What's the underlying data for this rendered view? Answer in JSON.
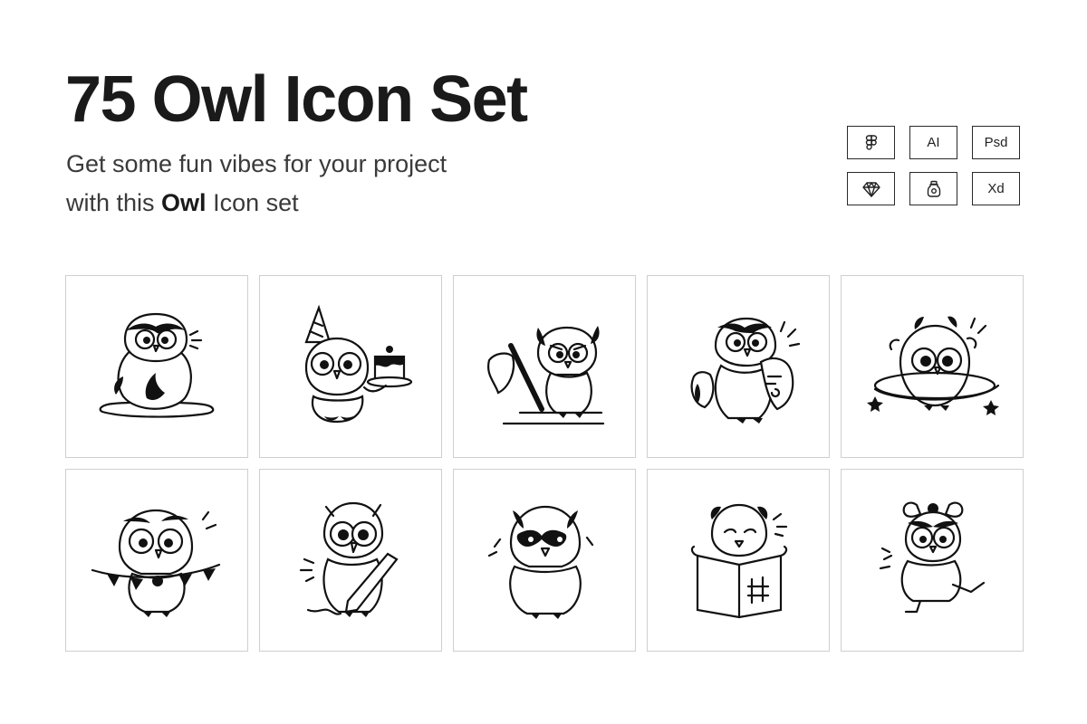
{
  "header": {
    "title": "75 Owl Icon Set",
    "subtitle_line1": "Get some fun vibes for your project",
    "subtitle_line2_prefix": "with this ",
    "subtitle_line2_bold": "Owl",
    "subtitle_line2_suffix": " Icon set"
  },
  "formats": [
    {
      "label": "",
      "icon": "figma-icon"
    },
    {
      "label": "AI",
      "icon": ""
    },
    {
      "label": "Psd",
      "icon": ""
    },
    {
      "label": "",
      "icon": "sketch-icon"
    },
    {
      "label": "",
      "icon": "craft-jar-icon"
    },
    {
      "label": "Xd",
      "icon": ""
    }
  ],
  "icons": [
    {
      "name": "owl-puddle-icon"
    },
    {
      "name": "owl-party-cake-icon"
    },
    {
      "name": "owl-stick-icon"
    },
    {
      "name": "owl-scroll-icon"
    },
    {
      "name": "owl-rings-icon"
    },
    {
      "name": "owl-bunting-icon"
    },
    {
      "name": "owl-pencil-icon"
    },
    {
      "name": "owl-mask-icon"
    },
    {
      "name": "owl-board-icon"
    },
    {
      "name": "owl-bow-icon"
    }
  ],
  "colors": {
    "text": "#1a1a1a",
    "border": "#cfcfcf",
    "ink": "#111111"
  }
}
